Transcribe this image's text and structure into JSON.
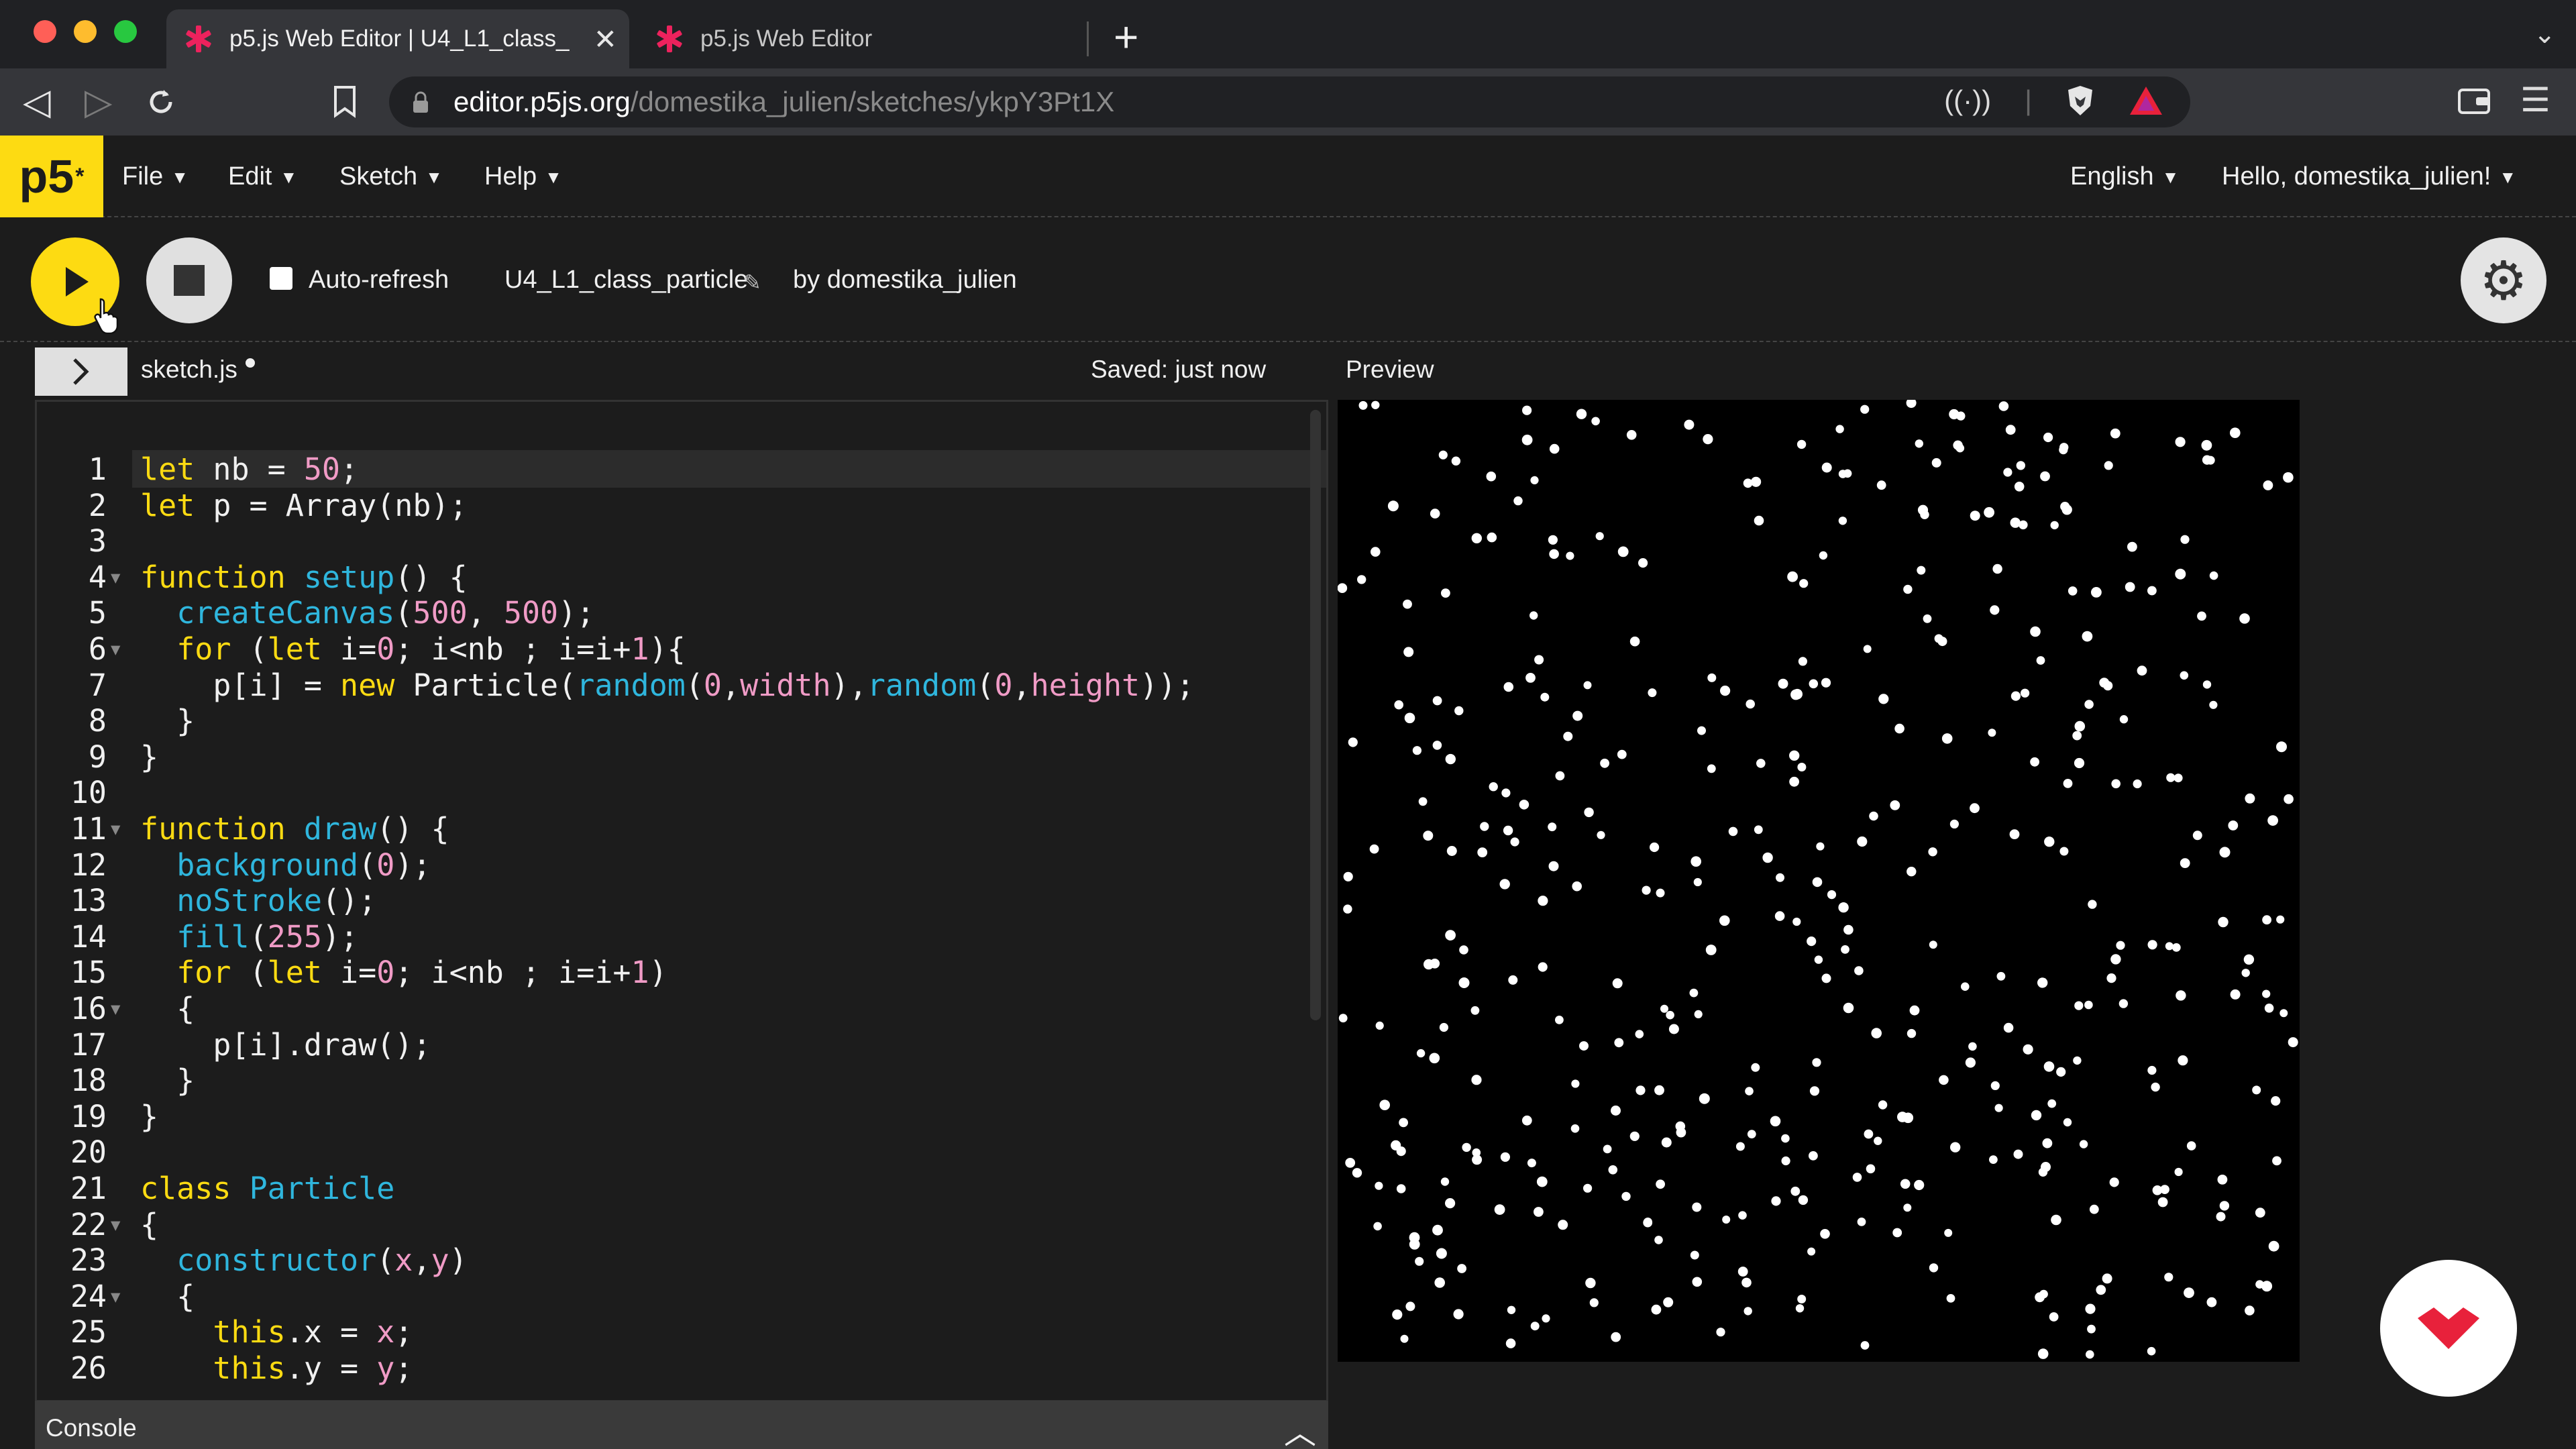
{
  "browser": {
    "tabs": [
      {
        "title": "p5.js Web Editor | U4_L1_class_",
        "active": true
      },
      {
        "title": "p5.js Web Editor",
        "active": false
      }
    ],
    "url_host": "editor.p5js.org",
    "url_path": "/domestika_julien/sketches/ykpY3Pt1X"
  },
  "menubar": {
    "logo": "p5",
    "logo_sup": "*",
    "items": [
      "File",
      "Edit",
      "Sketch",
      "Help"
    ],
    "language": "English",
    "user": "Hello, domestika_julien!"
  },
  "sketch_toolbar": {
    "auto_refresh_label": "Auto-refresh",
    "sketch_name": "U4_L1_class_particle",
    "author": "by domestika_julien"
  },
  "editor": {
    "file_name": "sketch.js",
    "saved_status": "Saved: just now",
    "preview_label": "Preview",
    "console_label": "Console",
    "lines": [
      "let nb = 50;",
      "let p = Array(nb);",
      "",
      "function setup() {",
      "  createCanvas(500, 500);",
      "  for (let i=0; i<nb ; i=i+1){",
      "    p[i] = new Particle(random(0,width),random(0,height));",
      "  }",
      "}",
      "",
      "function draw() {",
      "  background(0);",
      "  noStroke();",
      "  fill(255);",
      "  for (let i=0; i<nb ; i=i+1)",
      "  {",
      "    p[i].draw();",
      "  }",
      "}",
      "",
      "class Particle",
      "{",
      "  constructor(x,y)",
      "  {",
      "    this.x = x;",
      "    this.y = y;"
    ]
  },
  "colors": {
    "p5_yellow": "#fddb12",
    "p5_pink": "#ed225d",
    "keyword": "#fddb12",
    "function": "#2fb6dd",
    "number": "#f09bc6",
    "domestika_red": "#e8213b"
  },
  "icons": {
    "play": "play-icon",
    "stop": "stop-icon",
    "settings": "gear-icon",
    "expand": "chevron-right-icon",
    "console_toggle": "chevron-up-icon"
  }
}
